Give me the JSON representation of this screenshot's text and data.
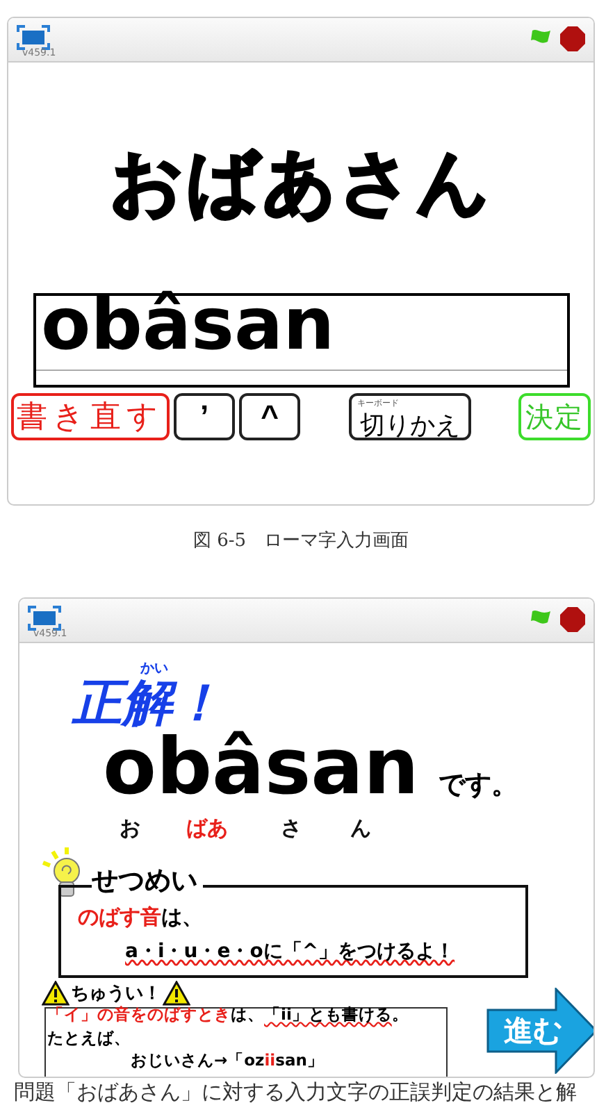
{
  "figure_1": {
    "player": {
      "version": "v459.1"
    },
    "prompt": "おばあさん",
    "answer_field": {
      "value": "obâsan"
    },
    "buttons": [
      {
        "kind": "erase",
        "label": "書き直す"
      },
      {
        "kind": "key",
        "label": "’"
      },
      {
        "kind": "key",
        "label": "^"
      },
      {
        "kind": "switch",
        "label": "切りかえ",
        "note": "キーボード"
      },
      {
        "kind": "confirm",
        "label": "決定"
      }
    ],
    "caption": "図 6-5　ローマ字入力画面"
  },
  "figure_2": {
    "player": {
      "version": "v459.1"
    },
    "heading": "正解！",
    "heading_ruby": "かい",
    "answer": "obâsan",
    "answer_suffix": "です。",
    "readings": [
      {
        "text": "お",
        "highlight": false
      },
      {
        "text": "ばあ",
        "highlight": true
      },
      {
        "text": "さ",
        "highlight": false
      },
      {
        "text": "ん",
        "highlight": false
      }
    ],
    "explanation": {
      "title": "せつめい",
      "lines": [
        [
          {
            "text": "のばす音",
            "emphasis": true,
            "underline": false
          },
          {
            "text": "は、",
            "emphasis": false,
            "underline": false
          }
        ],
        [
          {
            "text": "a・i・u・e・oに「^」をつけるよ！",
            "emphasis": false,
            "underline": true
          }
        ]
      ]
    },
    "warning": {
      "title": "ちゅうい！",
      "lines": [
        [
          {
            "text": "「イ」の音をのばすとき",
            "emphasis": true,
            "underline": false
          },
          {
            "text": "は、",
            "emphasis": false,
            "underline": false
          },
          {
            "text": "「ii」とも書ける",
            "emphasis": false,
            "underline": true
          },
          {
            "text": "。",
            "emphasis": false,
            "underline": false
          }
        ],
        [
          {
            "text": "たとえば、",
            "emphasis": false,
            "underline": false
          }
        ],
        [
          {
            "text": "おじいさん→「oz",
            "emphasis": false,
            "underline": false
          },
          {
            "text": "ii",
            "emphasis": true,
            "underline": false
          },
          {
            "text": "san」",
            "emphasis": false,
            "underline": false
          }
        ]
      ]
    },
    "next_button": "進む"
  },
  "caption_2": "問題「おばあさん」に対する入力文字の正誤判定の結果と解"
}
